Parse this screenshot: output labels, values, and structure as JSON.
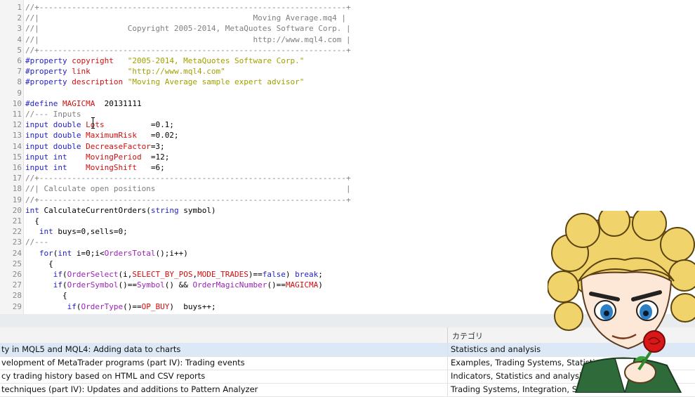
{
  "editor": {
    "lines": [
      {
        "n": "1",
        "tokens": [
          {
            "t": "//+------------------------------------------------------------------+",
            "c": "comment"
          }
        ]
      },
      {
        "n": "2",
        "tokens": [
          {
            "t": "//|                                              Moving Average.mq4 |",
            "c": "comment"
          }
        ]
      },
      {
        "n": "3",
        "tokens": [
          {
            "t": "//|                   Copyright 2005-2014, MetaQuotes Software Corp. |",
            "c": "comment"
          }
        ]
      },
      {
        "n": "4",
        "tokens": [
          {
            "t": "//|                                              http://www.mql4.com |",
            "c": "comment"
          }
        ]
      },
      {
        "n": "5",
        "tokens": [
          {
            "t": "//+------------------------------------------------------------------+",
            "c": "comment"
          }
        ]
      },
      {
        "n": "6",
        "tokens": [
          {
            "t": "#property ",
            "c": "keyword"
          },
          {
            "t": "copyright",
            "c": "prop"
          },
          {
            "t": "   \"2005-2014, MetaQuotes Software Corp.\"",
            "c": "string"
          }
        ]
      },
      {
        "n": "7",
        "tokens": [
          {
            "t": "#property ",
            "c": "keyword"
          },
          {
            "t": "link",
            "c": "prop"
          },
          {
            "t": "        \"http://www.mql4.com\"",
            "c": "string"
          }
        ]
      },
      {
        "n": "8",
        "tokens": [
          {
            "t": "#property ",
            "c": "keyword"
          },
          {
            "t": "description",
            "c": "prop"
          },
          {
            "t": " \"Moving Average sample expert advisor\"",
            "c": "string"
          }
        ]
      },
      {
        "n": "9",
        "tokens": []
      },
      {
        "n": "10",
        "tokens": [
          {
            "t": "#define ",
            "c": "keyword"
          },
          {
            "t": "MAGICMA",
            "c": "prop"
          },
          {
            "t": "  20131111",
            "c": "plain"
          }
        ]
      },
      {
        "n": "11",
        "tokens": [
          {
            "t": "//--- Inputs",
            "c": "comment"
          }
        ]
      },
      {
        "n": "12",
        "tokens": [
          {
            "t": "input double ",
            "c": "keyword"
          },
          {
            "t": "Lots",
            "c": "prop"
          },
          {
            "t": "          =0.1;",
            "c": "plain"
          }
        ]
      },
      {
        "n": "13",
        "tokens": [
          {
            "t": "input double ",
            "c": "keyword"
          },
          {
            "t": "MaximumRisk",
            "c": "prop"
          },
          {
            "t": "   =0.02;",
            "c": "plain"
          }
        ]
      },
      {
        "n": "14",
        "tokens": [
          {
            "t": "input double ",
            "c": "keyword"
          },
          {
            "t": "DecreaseFactor",
            "c": "prop"
          },
          {
            "t": "=3;",
            "c": "plain"
          }
        ]
      },
      {
        "n": "15",
        "tokens": [
          {
            "t": "input int    ",
            "c": "keyword"
          },
          {
            "t": "MovingPeriod",
            "c": "prop"
          },
          {
            "t": "  =12;",
            "c": "plain"
          }
        ]
      },
      {
        "n": "16",
        "tokens": [
          {
            "t": "input int    ",
            "c": "keyword"
          },
          {
            "t": "MovingShift",
            "c": "prop"
          },
          {
            "t": "   =6;",
            "c": "plain"
          }
        ]
      },
      {
        "n": "17",
        "tokens": [
          {
            "t": "//+------------------------------------------------------------------+",
            "c": "comment"
          }
        ]
      },
      {
        "n": "18",
        "tokens": [
          {
            "t": "//| Calculate open positions                                         |",
            "c": "comment"
          }
        ]
      },
      {
        "n": "19",
        "tokens": [
          {
            "t": "//+------------------------------------------------------------------+",
            "c": "comment"
          }
        ]
      },
      {
        "n": "20",
        "tokens": [
          {
            "t": "int ",
            "c": "keyword"
          },
          {
            "t": "CalculateCurrentOrders(",
            "c": "plain"
          },
          {
            "t": "string",
            "c": "keyword"
          },
          {
            "t": " symbol)",
            "c": "plain"
          }
        ]
      },
      {
        "n": "21",
        "tokens": [
          {
            "t": "  {",
            "c": "plain"
          }
        ]
      },
      {
        "n": "22",
        "tokens": [
          {
            "t": "   int ",
            "c": "keyword"
          },
          {
            "t": "buys=0,sells=0;",
            "c": "plain"
          }
        ]
      },
      {
        "n": "23",
        "tokens": [
          {
            "t": "//---",
            "c": "comment"
          }
        ]
      },
      {
        "n": "24",
        "tokens": [
          {
            "t": "   for",
            "c": "keyword"
          },
          {
            "t": "(",
            "c": "plain"
          },
          {
            "t": "int ",
            "c": "keyword"
          },
          {
            "t": "i=0;i<",
            "c": "plain"
          },
          {
            "t": "OrdersTotal",
            "c": "func"
          },
          {
            "t": "();i++)",
            "c": "plain"
          }
        ]
      },
      {
        "n": "25",
        "tokens": [
          {
            "t": "     {",
            "c": "plain"
          }
        ]
      },
      {
        "n": "26",
        "tokens": [
          {
            "t": "      if",
            "c": "keyword"
          },
          {
            "t": "(",
            "c": "plain"
          },
          {
            "t": "OrderSelect",
            "c": "func"
          },
          {
            "t": "(i,",
            "c": "plain"
          },
          {
            "t": "SELECT_BY_POS",
            "c": "prop"
          },
          {
            "t": ",",
            "c": "plain"
          },
          {
            "t": "MODE_TRADES",
            "c": "prop"
          },
          {
            "t": ")==",
            "c": "plain"
          },
          {
            "t": "false",
            "c": "keyword"
          },
          {
            "t": ") ",
            "c": "plain"
          },
          {
            "t": "break",
            "c": "keyword"
          },
          {
            "t": ";",
            "c": "plain"
          }
        ]
      },
      {
        "n": "27",
        "tokens": [
          {
            "t": "      if",
            "c": "keyword"
          },
          {
            "t": "(",
            "c": "plain"
          },
          {
            "t": "OrderSymbol",
            "c": "func"
          },
          {
            "t": "()==",
            "c": "plain"
          },
          {
            "t": "Symbol",
            "c": "func"
          },
          {
            "t": "() && ",
            "c": "plain"
          },
          {
            "t": "OrderMagicNumber",
            "c": "func"
          },
          {
            "t": "()==",
            "c": "plain"
          },
          {
            "t": "MAGICMA",
            "c": "prop"
          },
          {
            "t": ")",
            "c": "plain"
          }
        ]
      },
      {
        "n": "28",
        "tokens": [
          {
            "t": "        {",
            "c": "plain"
          }
        ]
      },
      {
        "n": "29",
        "tokens": [
          {
            "t": "         if",
            "c": "keyword"
          },
          {
            "t": "(",
            "c": "plain"
          },
          {
            "t": "OrderType",
            "c": "func"
          },
          {
            "t": "()==",
            "c": "plain"
          },
          {
            "t": "OP_BUY",
            "c": "prop"
          },
          {
            "t": ")  buys++;",
            "c": "plain"
          }
        ]
      }
    ]
  },
  "articles": {
    "column_category": "カテゴリ",
    "rows": [
      {
        "title": "ty in MQL5 and MQL4: Adding data to charts",
        "category": "Statistics and analysis",
        "selected": true
      },
      {
        "title": "velopment of MetaTrader programs (part IV): Trading events",
        "category": "Examples, Trading Systems, Statistics",
        "selected": false
      },
      {
        "title": "cy trading history based on HTML and CSV reports",
        "category": "Indicators, Statistics and analysis",
        "selected": false
      },
      {
        "title": " techniques (part IV): Updates and additions to Pattern Analyzer",
        "category": "Trading Systems, Integration, Statistic",
        "selected": false
      }
    ]
  },
  "colors": {
    "comment": "#808080",
    "keyword": "#1f1fc8",
    "prop": "#d01010",
    "string": "#a0a000",
    "func": "#9b22b8",
    "selected_row": "#dce8f6"
  }
}
